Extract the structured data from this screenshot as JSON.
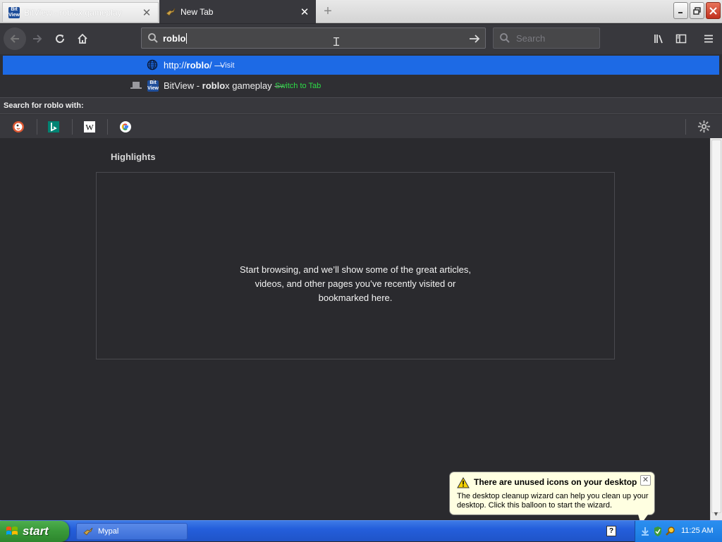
{
  "tabs": [
    {
      "title": "BitView - roblox gameplay",
      "favicon": "bitview-favicon"
    },
    {
      "title": "New Tab",
      "favicon": "mypal-favicon"
    }
  ],
  "urlbar": {
    "value": "roblo"
  },
  "searchbar": {
    "placeholder": "Search"
  },
  "dropdown": {
    "visit": {
      "url_prefix": "http://",
      "url_bold": "roblo",
      "url_suffix": "/",
      "dash": "—",
      "action": "Visit"
    },
    "switch": {
      "title_prefix": "BitView - ",
      "title_bold": "roblo",
      "title_suffix": "x gameplay",
      "dash": "—",
      "action": "Switch to Tab"
    },
    "search_with": "Search for roblo with:",
    "engines": [
      "duckduckgo-icon",
      "bing-icon",
      "wikipedia-icon",
      "google-icon"
    ]
  },
  "content": {
    "highlights_title": "Highlights",
    "highlights_message": "Start browsing, and we’ll show some of the great articles, videos, and other pages you’ve recently visited or bookmarked here."
  },
  "balloon": {
    "title": "There are unused icons on your desktop",
    "body": "The desktop cleanup wizard can help you clean up your desktop. Click this balloon to start the wizard."
  },
  "taskbar": {
    "start_label": "start",
    "task": "Mypal",
    "help": "?",
    "clock": "11:25 AM"
  },
  "colors": {
    "accent": "#1d6ae5",
    "switch_tab": "#2ddc47",
    "content_bg": "#2a2a2e",
    "toolbar_bg": "#38383d"
  }
}
